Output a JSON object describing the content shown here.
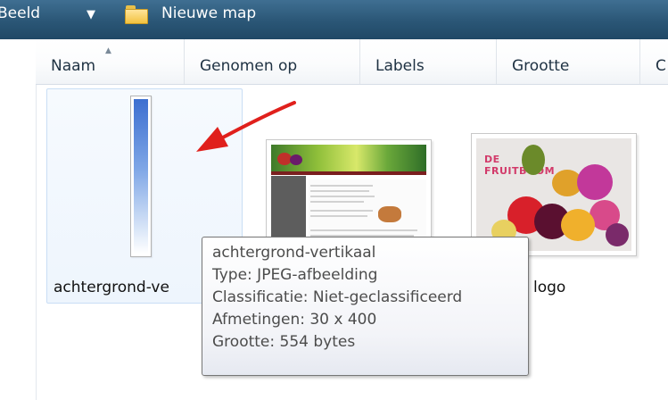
{
  "toolbar": {
    "view_label": "Beeld",
    "dropdown_icon": "chevron-down-icon",
    "folder_icon": "folder-icon",
    "folder_name": "Nieuwe map"
  },
  "columns": [
    {
      "label": "Naam",
      "sorted": "ascending"
    },
    {
      "label": "Genomen op"
    },
    {
      "label": "Labels"
    },
    {
      "label": "Grootte"
    },
    {
      "label": "C"
    }
  ],
  "items": [
    {
      "label": "achtergrond-ve",
      "selected": true
    },
    {
      "label": ""
    },
    {
      "label": "logo"
    }
  ],
  "logo_thumbnail": {
    "title_line1": "DE",
    "title_line2": "FRUITBOOM"
  },
  "arrow": {
    "color": "#e0201c",
    "icon": "red-arrow-icon"
  },
  "tooltip": {
    "name": "achtergrond-vertikaal",
    "type": "Type: JPEG-afbeelding",
    "rating": "Classificatie: Niet-geclassificeerd",
    "dimensions": "Afmetingen: 30 x 400",
    "size": "Grootte: 554 bytes"
  },
  "colors": {
    "toolbar": "#2c5878",
    "selection": "#eef5fd",
    "selection_border": "#c9def5"
  }
}
